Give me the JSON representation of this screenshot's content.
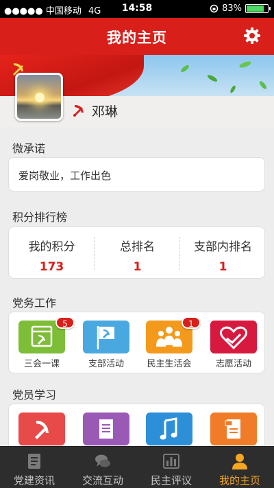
{
  "status_bar": {
    "carrier": "●●●●● 中国移动",
    "network": "4G",
    "time": "14:58",
    "battery": "83%",
    "battery_level": 0.83
  },
  "header": {
    "title": "我的主页",
    "settings_icon": "gear-icon"
  },
  "profile": {
    "name": "邓琳",
    "badge_icon": "party-emblem-icon"
  },
  "pledge": {
    "title": "微承诺",
    "text": "爱岗敬业，工作出色"
  },
  "ranking": {
    "title": "积分排行榜",
    "columns": [
      {
        "label": "我的积分",
        "value": "173"
      },
      {
        "label": "总排名",
        "value": "1"
      },
      {
        "label": "支部内排名",
        "value": "1"
      }
    ]
  },
  "party_work": {
    "title": "党务工作",
    "items": [
      {
        "label": "三会一课",
        "icon": "calendar-party-icon",
        "color": "#7dbd37",
        "badge": "5"
      },
      {
        "label": "支部活动",
        "icon": "flag-party-icon",
        "color": "#4aa8e0",
        "badge": ""
      },
      {
        "label": "民主生活会",
        "icon": "people-group-icon",
        "color": "#f39a1c",
        "badge": "1"
      },
      {
        "label": "志愿活动",
        "icon": "heart-hand-icon",
        "color": "#d8193f",
        "badge": ""
      }
    ]
  },
  "member_study": {
    "title": "党员学习",
    "items": [
      {
        "icon": "party-emblem-icon",
        "color": "#e84a4a"
      },
      {
        "icon": "document-icon",
        "color": "#9b59b6"
      },
      {
        "icon": "music-note-icon",
        "color": "#2d8fd8"
      },
      {
        "icon": "word-document-icon",
        "color": "#f07c2a"
      }
    ]
  },
  "tabbar": {
    "items": [
      {
        "label": "党建资讯",
        "icon": "news-icon"
      },
      {
        "label": "交流互动",
        "icon": "chat-bubbles-icon"
      },
      {
        "label": "民主评议",
        "icon": "bar-chart-icon"
      },
      {
        "label": "我的主页",
        "icon": "user-icon",
        "active": true
      }
    ]
  }
}
